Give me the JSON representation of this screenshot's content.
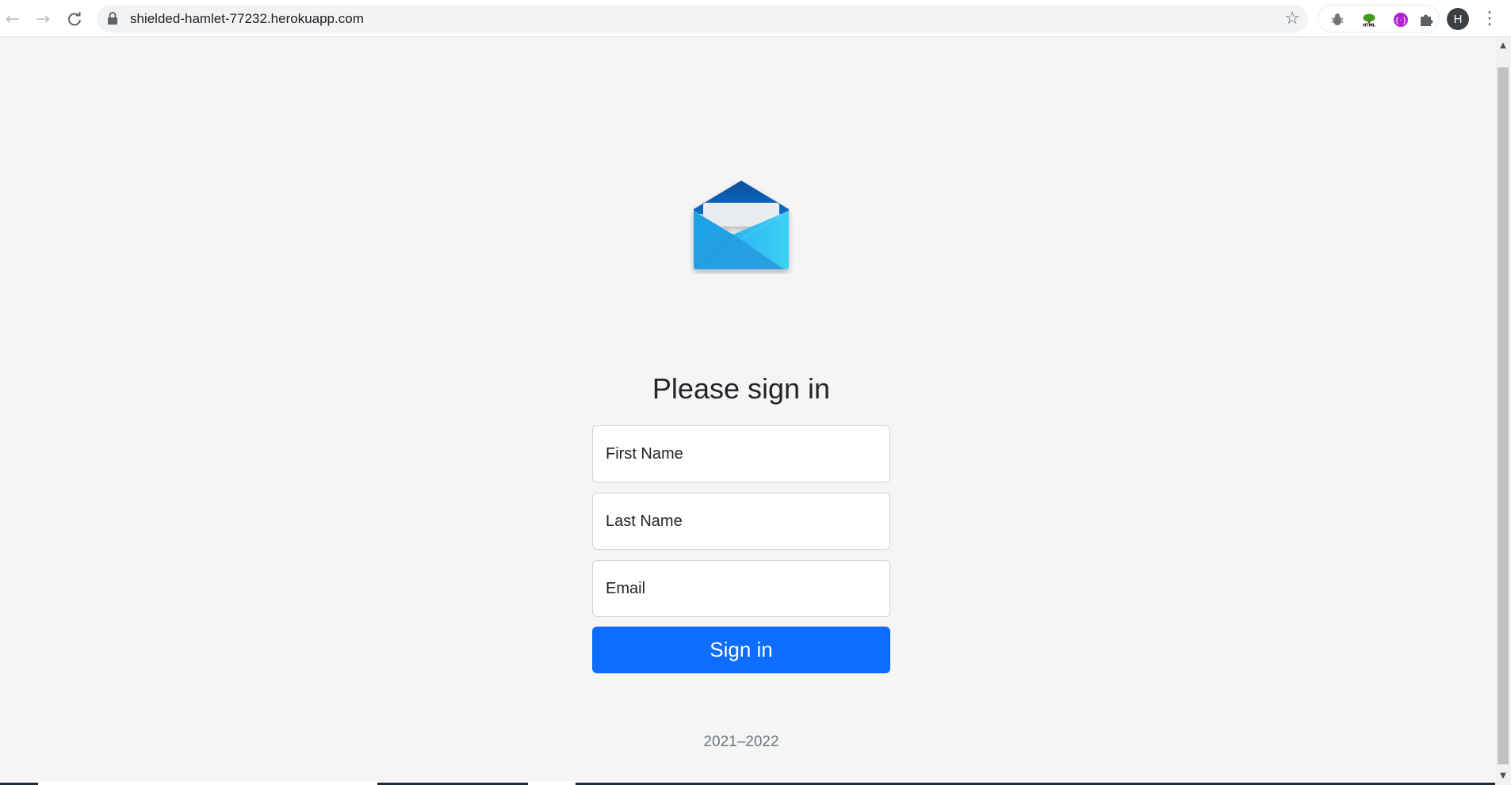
{
  "browser": {
    "url": "shielded-hamlet-77232.herokuapp.com",
    "profile_initial": "H",
    "icons": {
      "back": "arrow-left-icon",
      "forward": "arrow-right-icon",
      "reload": "reload-icon",
      "lock": "lock-icon",
      "bookmark": "star-icon",
      "extensions": [
        "bug-extension-icon",
        "html-tree-extension-icon",
        "purple-extension-icon",
        "puzzle-extension-icon"
      ],
      "menu": "kebab-menu-icon"
    }
  },
  "page": {
    "logo": "open-envelope-mail-logo",
    "title": "Please sign in",
    "form": {
      "first_name_placeholder": "First Name",
      "last_name_placeholder": "Last Name",
      "email_placeholder": "Email",
      "submit_label": "Sign in"
    },
    "footer": "2021–2022"
  },
  "colors": {
    "primary": "#0d6efd",
    "background": "#f5f5f5",
    "envelope_dark": "#0a5cb5",
    "envelope_light": "#2fc6f5"
  }
}
